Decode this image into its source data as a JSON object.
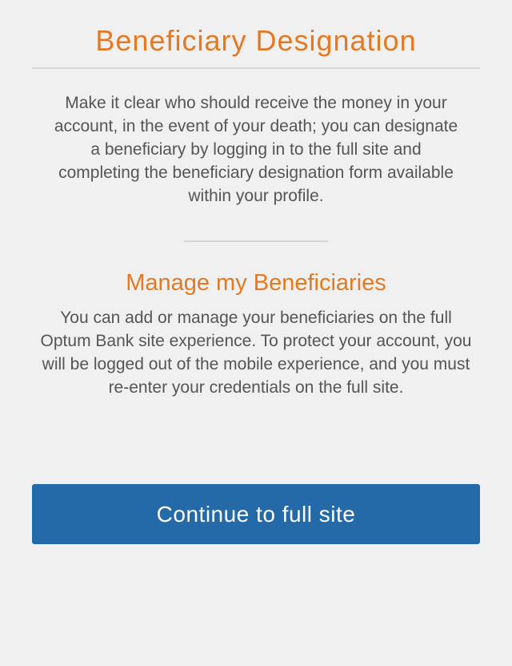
{
  "header": {
    "title": "Beneficiary Designation"
  },
  "intro": {
    "text": "Make it clear who should receive the money in your account, in the event of your death; you can designate a beneficiary by logging in to the full site and completing the beneficiary designation form available within your profile."
  },
  "manage": {
    "title": "Manage my Beneficiaries",
    "text": "You can add or manage your beneficiaries on the full Optum Bank site experience.  To protect your account, you will be logged out of the mobile experience, and you must re-enter your credentials on the full site."
  },
  "actions": {
    "continue_label": "Continue to full site"
  },
  "colors": {
    "accent": "#e37a23",
    "button": "#246aa9",
    "background": "#f0f0f0",
    "body_text": "#555558"
  }
}
